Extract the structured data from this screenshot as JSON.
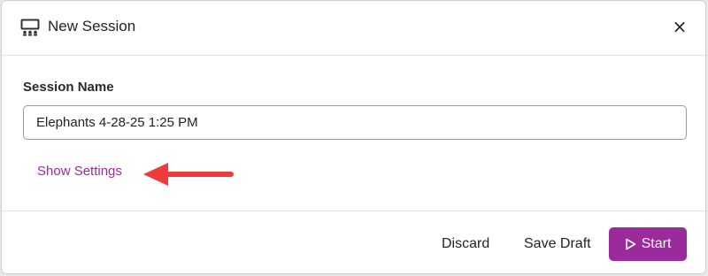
{
  "dialog": {
    "title": "New Session",
    "title_icon": "presentation-audience-icon",
    "close_icon": "close-icon",
    "close_label": "×"
  },
  "form": {
    "session_name_label": "Session Name",
    "session_name_value": "Elephants 4-28-25 1:25 PM",
    "show_settings_label": "Show Settings"
  },
  "footer": {
    "discard_label": "Discard",
    "save_draft_label": "Save Draft",
    "start_label": "Start",
    "start_icon": "play-icon"
  },
  "colors": {
    "accent": "#9b2a9c",
    "annotation_arrow": "#ef3b3b"
  },
  "annotation": {
    "arrow_icon": "left-arrow-annotation"
  }
}
